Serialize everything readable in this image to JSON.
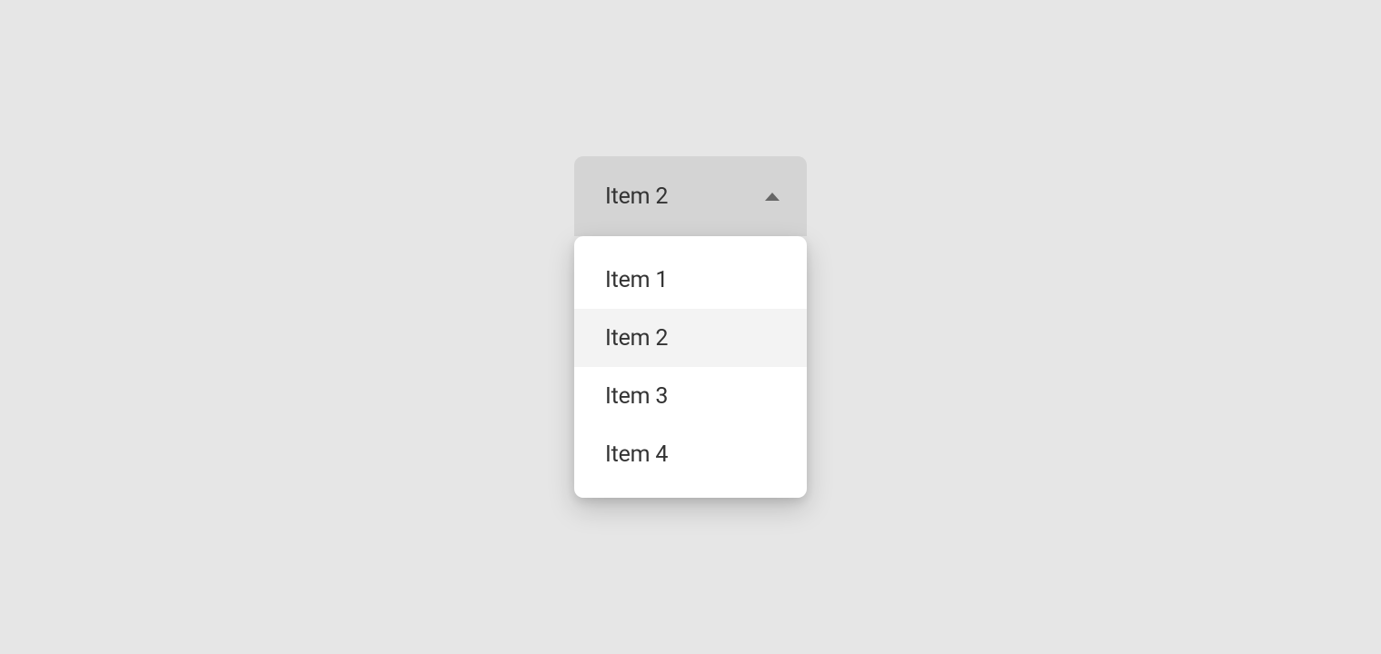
{
  "dropdown": {
    "selected_label": "Item 2",
    "options": [
      {
        "label": "Item 1",
        "highlighted": false
      },
      {
        "label": "Item 2",
        "highlighted": true
      },
      {
        "label": "Item 3",
        "highlighted": false
      },
      {
        "label": "Item 4",
        "highlighted": false
      }
    ]
  }
}
